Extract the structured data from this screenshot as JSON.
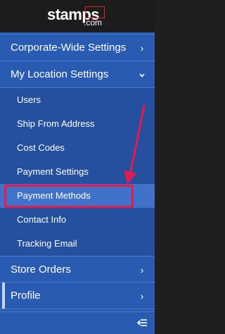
{
  "brand": {
    "logo_text": "stamps",
    "logo_suffix": ".com",
    "accent_color": "#d9262e"
  },
  "menu": {
    "corporate": {
      "label": "Corporate-Wide Settings",
      "icon": "chevron-right-icon"
    },
    "my_location": {
      "label": "My Location Settings",
      "icon": "chevron-down-icon",
      "items": [
        {
          "label": "Users"
        },
        {
          "label": "Ship From Address"
        },
        {
          "label": "Cost Codes"
        },
        {
          "label": "Payment Settings"
        },
        {
          "label": "Payment Methods"
        },
        {
          "label": "Contact Info"
        },
        {
          "label": "Tracking Email"
        }
      ]
    },
    "store_orders": {
      "label": "Store Orders",
      "icon": "chevron-right-icon"
    },
    "profile": {
      "label": "Profile",
      "icon": "chevron-right-icon"
    }
  },
  "footer": {
    "icon": "collapse-sidebar-icon"
  },
  "colors": {
    "sidebar_bg": "#2a5bb3",
    "submenu_bg": "#24509f",
    "active_bg": "#3f72c8",
    "annotation": "#e8194c"
  }
}
